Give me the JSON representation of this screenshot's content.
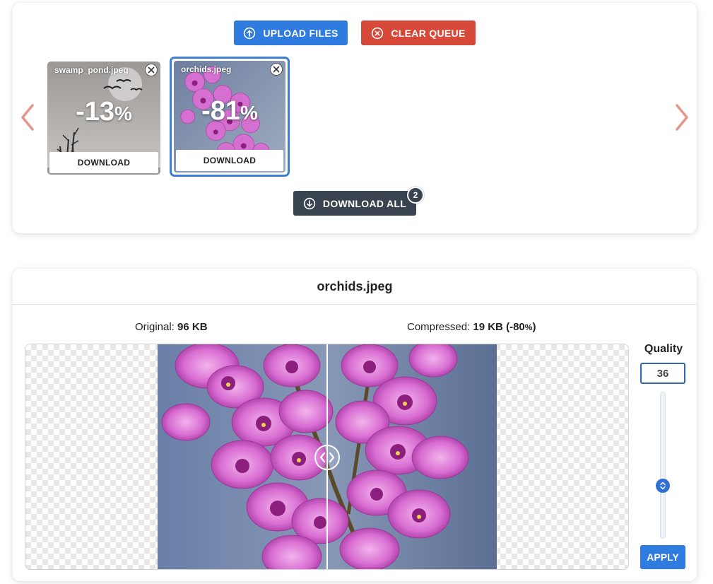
{
  "toolbar": {
    "upload_label": "UPLOAD FILES",
    "clear_label": "CLEAR QUEUE",
    "download_all_label": "DOWNLOAD ALL",
    "download_all_count": "2"
  },
  "queue": [
    {
      "name": "swamp_pond.jpeg",
      "percent": "-13",
      "percent_sign": "%",
      "download_label": "DOWNLOAD",
      "selected": false
    },
    {
      "name": "orchids.jpeg",
      "percent": "-81",
      "percent_sign": "%",
      "download_label": "DOWNLOAD",
      "selected": true
    }
  ],
  "compare": {
    "title": "orchids.jpeg",
    "original_label": "Original:",
    "original_size": "96 KB",
    "compressed_label": "Compressed:",
    "compressed_size": "19 KB",
    "compressed_percent": "(-80",
    "compressed_percent_sign": "%",
    "compressed_percent_close": ")"
  },
  "quality": {
    "label": "Quality",
    "value": "36",
    "slider_fraction": 0.36,
    "apply_label": "APPLY"
  },
  "colors": {
    "primary": "#2f7be0",
    "danger": "#d64838",
    "dark": "#3a4350",
    "arrow": "#e4968a",
    "selected_border": "#3a7ed6"
  },
  "icons": {
    "upload": "arrow-up-circle-icon",
    "clear": "x-circle-icon",
    "download_all": "arrow-down-circle-icon",
    "prev": "chevron-left-icon",
    "next": "chevron-right-icon",
    "close": "close-icon",
    "split": "chevrons-left-right-icon",
    "slider": "chevrons-up-down-icon"
  }
}
